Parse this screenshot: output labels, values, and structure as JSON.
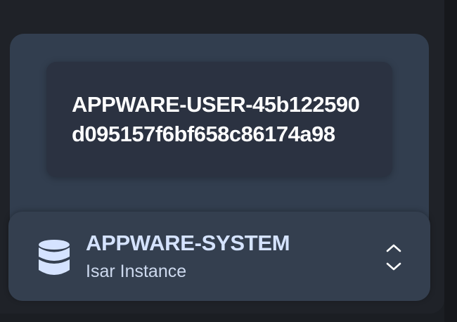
{
  "user_card": {
    "user_id_line1": "APPWARE-USER-45b122590",
    "user_id_line2": "d095157f6bf658c86174a98"
  },
  "instance_selector": {
    "icon": "database-icon",
    "title": "APPWARE-SYSTEM",
    "subtitle": "Isar Instance",
    "toggle_icon": "unfold-more-icon"
  },
  "colors": {
    "background": "#1b1e23",
    "card": "#323e4f",
    "id_box": "#2b3241",
    "accent_text": "#d5e3ff"
  }
}
